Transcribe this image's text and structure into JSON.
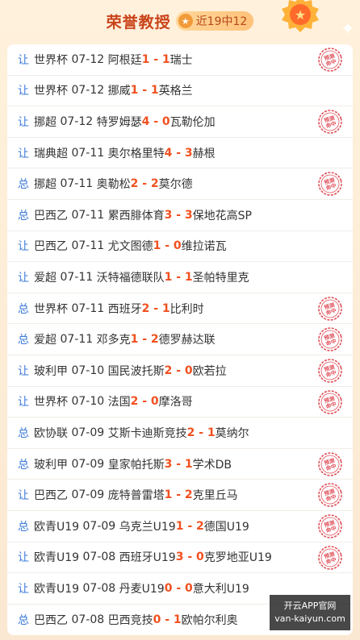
{
  "header": {
    "title": "荣誉教授",
    "record": "近19中12"
  },
  "stamp_text": "预测命中",
  "rows": [
    {
      "type": "让",
      "league": "世界杯",
      "date": "07-12",
      "home": "阿根廷",
      "hs": "1",
      "as": "1",
      "away": "瑞士",
      "hit": true
    },
    {
      "type": "让",
      "league": "世界杯",
      "date": "07-12",
      "home": "挪威",
      "hs": "1",
      "as": "1",
      "away": "英格兰",
      "hit": false
    },
    {
      "type": "让",
      "league": "挪超",
      "date": "07-12",
      "home": "特罗姆瑟",
      "hs": "4",
      "as": "0",
      "away": "瓦勒伦加",
      "hit": true
    },
    {
      "type": "让",
      "league": "瑞典超",
      "date": "07-11",
      "home": "奥尔格里特",
      "hs": "4",
      "as": "3",
      "away": "赫根",
      "hit": false
    },
    {
      "type": "总",
      "league": "挪超",
      "date": "07-11",
      "home": "奥勒松",
      "hs": "2",
      "as": "2",
      "away": "莫尔德",
      "hit": true
    },
    {
      "type": "总",
      "league": "巴西乙",
      "date": "07-11",
      "home": "累西腓体育",
      "hs": "3",
      "as": "3",
      "away": "保地花高SP",
      "hit": false
    },
    {
      "type": "让",
      "league": "巴西乙",
      "date": "07-11",
      "home": "尤文图德",
      "hs": "1",
      "as": "0",
      "away": "维拉诺瓦",
      "hit": false
    },
    {
      "type": "让",
      "league": "爱超",
      "date": "07-11",
      "home": "沃特福德联队",
      "hs": "1",
      "as": "1",
      "away": "圣帕特里克",
      "hit": false
    },
    {
      "type": "总",
      "league": "世界杯",
      "date": "07-11",
      "home": "西班牙",
      "hs": "2",
      "as": "1",
      "away": "比利时",
      "hit": true
    },
    {
      "type": "总",
      "league": "爱超",
      "date": "07-11",
      "home": "邓多克",
      "hs": "1",
      "as": "2",
      "away": "德罗赫达联",
      "hit": true
    },
    {
      "type": "让",
      "league": "玻利甲",
      "date": "07-10",
      "home": "国民波托斯",
      "hs": "2",
      "as": "0",
      "away": "欧若拉",
      "hit": true
    },
    {
      "type": "让",
      "league": "世界杯",
      "date": "07-10",
      "home": "法国",
      "hs": "2",
      "as": "0",
      "away": "摩洛哥",
      "hit": true
    },
    {
      "type": "总",
      "league": "欧协联",
      "date": "07-09",
      "home": "艾斯卡迪斯竞技",
      "hs": "2",
      "as": "1",
      "away": "莫纳尔",
      "hit": false
    },
    {
      "type": "总",
      "league": "玻利甲",
      "date": "07-09",
      "home": "皇家帕托斯",
      "hs": "3",
      "as": "1",
      "away": "学术DB",
      "hit": true
    },
    {
      "type": "让",
      "league": "巴西乙",
      "date": "07-09",
      "home": "庞特普雷塔",
      "hs": "1",
      "as": "2",
      "away": "克里丘马",
      "hit": true
    },
    {
      "type": "总",
      "league": "欧青U19",
      "date": "07-09",
      "home": "乌克兰U19",
      "hs": "1",
      "as": "2",
      "away": "德国U19",
      "hit": true
    },
    {
      "type": "让",
      "league": "欧青U19",
      "date": "07-08",
      "home": "西班牙U19",
      "hs": "3",
      "as": "0",
      "away": "克罗地亚U19",
      "hit": true
    },
    {
      "type": "让",
      "league": "欧青U19",
      "date": "07-08",
      "home": "丹麦U19",
      "hs": "0",
      "as": "0",
      "away": "意大利U19",
      "hit": false
    },
    {
      "type": "总",
      "league": "巴西乙",
      "date": "07-08",
      "home": "巴西竞技",
      "hs": "0",
      "as": "1",
      "away": "欧帕尔利奥",
      "hit": false
    }
  ],
  "watermark": {
    "line1": "开云APP官网",
    "line2": "van-kaiyun.com"
  }
}
